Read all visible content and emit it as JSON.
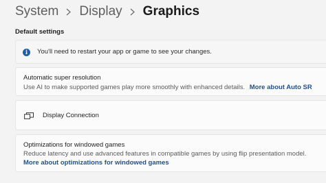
{
  "breadcrumb": {
    "items": [
      "System",
      "Display",
      "Graphics"
    ]
  },
  "section": {
    "title": "Default settings"
  },
  "info": {
    "icon": "info-icon",
    "text": "You'll need to restart your app or game to see your changes."
  },
  "auto_sr": {
    "title": "Automatic super resolution",
    "description": "Use AI to make supported games play more smoothly with enhanced details.",
    "link": "More about Auto SR"
  },
  "display_connection": {
    "icon": "display-connection-icon",
    "label": "Display Connection"
  },
  "windowed": {
    "title": "Optimizations for windowed games",
    "description": "Reduce latency and use advanced features in compatible games by using flip presentation model.",
    "link": "More about optimizations for windowed games"
  },
  "colors": {
    "accent": "#1f5fa8",
    "link": "#1f4f8f",
    "background": "#f3f3f3",
    "card": "#fbfbfb"
  }
}
